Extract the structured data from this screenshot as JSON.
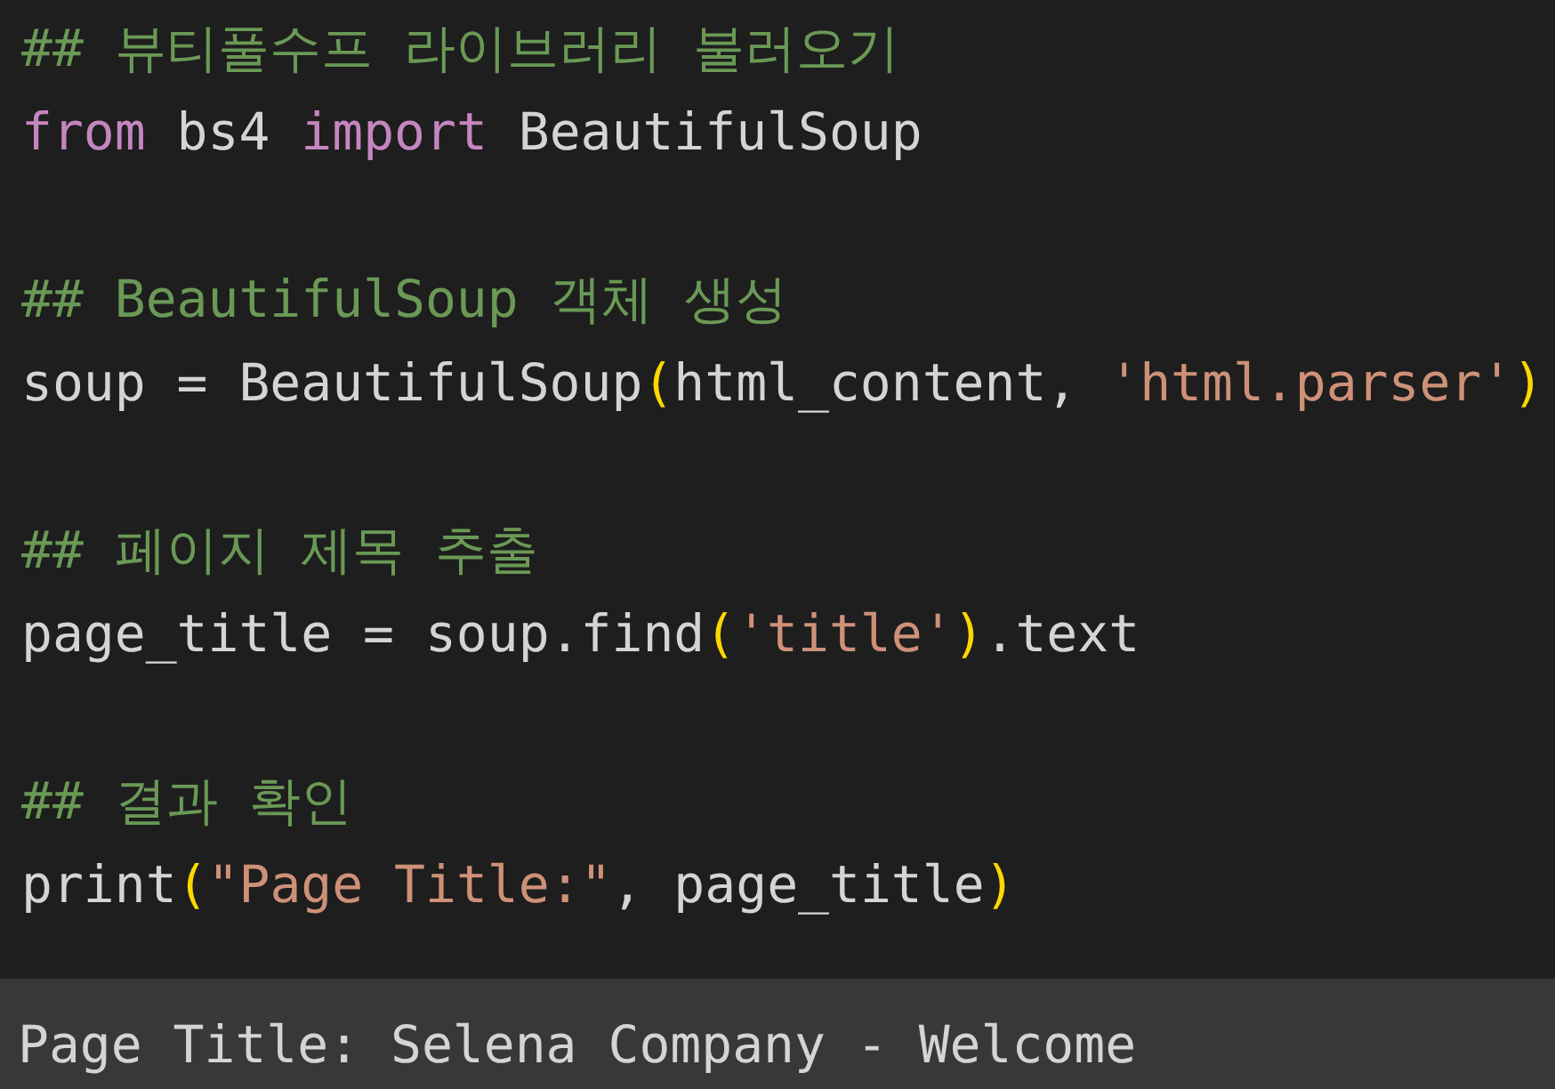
{
  "code_blocks": [
    {
      "lines": [
        [
          {
            "kind": "comment",
            "text": "## 뷰티풀수프 라이브러리 불러오기"
          }
        ],
        [
          {
            "kind": "keyword",
            "text": "from"
          },
          {
            "kind": "plain",
            "text": " bs4 "
          },
          {
            "kind": "keyword",
            "text": "import"
          },
          {
            "kind": "plain",
            "text": " BeautifulSoup"
          }
        ]
      ]
    },
    {
      "lines": [
        [
          {
            "kind": "comment",
            "text": "## BeautifulSoup 객체 생성"
          }
        ],
        [
          {
            "kind": "plain",
            "text": "soup = BeautifulSoup"
          },
          {
            "kind": "bracket",
            "text": "("
          },
          {
            "kind": "plain",
            "text": "html_content, "
          },
          {
            "kind": "string",
            "text": "'html.parser'"
          },
          {
            "kind": "bracket",
            "text": ")"
          }
        ]
      ]
    },
    {
      "lines": [
        [
          {
            "kind": "comment",
            "text": "## 페이지 제목 추출"
          }
        ],
        [
          {
            "kind": "plain",
            "text": "page_title = soup.find"
          },
          {
            "kind": "bracket",
            "text": "("
          },
          {
            "kind": "string",
            "text": "'title'"
          },
          {
            "kind": "bracket",
            "text": ")"
          },
          {
            "kind": "plain",
            "text": ".text"
          }
        ]
      ]
    },
    {
      "lines": [
        [
          {
            "kind": "comment",
            "text": "## 결과 확인"
          }
        ],
        [
          {
            "kind": "plain",
            "text": "print"
          },
          {
            "kind": "bracket",
            "text": "("
          },
          {
            "kind": "string",
            "text": "\"Page Title:\""
          },
          {
            "kind": "plain",
            "text": ", page_title"
          },
          {
            "kind": "bracket",
            "text": ")"
          }
        ]
      ]
    }
  ],
  "output": "Page Title: Selena Company - Welcome"
}
